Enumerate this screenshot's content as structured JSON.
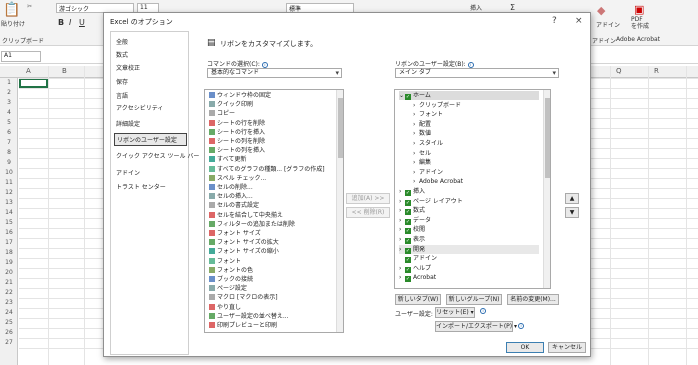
{
  "excel": {
    "font_name": "游ゴシック",
    "font_size": "11",
    "number_format": "標準",
    "clipboard_label": "クリップボード",
    "paste_label": "貼り付け",
    "insert_label": "挿入",
    "addin_label": "アドイン",
    "addin_group": "アドイン",
    "pdf_label": "PDF\nを作成",
    "acrobat_group": "Adobe Acrobat",
    "name_box": "A1",
    "columns": [
      "A",
      "B",
      "Q",
      "R"
    ],
    "rows": [
      "1",
      "2",
      "3",
      "4",
      "5",
      "6",
      "7",
      "8",
      "9",
      "10",
      "11",
      "12",
      "13",
      "14",
      "15",
      "16",
      "17",
      "18",
      "19",
      "20",
      "21",
      "22",
      "23",
      "24",
      "25",
      "26",
      "27"
    ]
  },
  "dialog": {
    "title": "Excel のオプション",
    "help": "?",
    "close": "×",
    "nav": [
      {
        "label": "全般"
      },
      {
        "label": "数式"
      },
      {
        "label": "文章校正"
      },
      {
        "label": "保存"
      },
      {
        "label": "言語"
      },
      {
        "label": "アクセシビリティ"
      },
      {
        "label": "詳細設定"
      },
      {
        "label": "リボンのユーザー設定"
      },
      {
        "label": "クイック アクセス ツール バー"
      },
      {
        "label": "アドイン"
      },
      {
        "label": "トラスト センター"
      }
    ],
    "header": "リボンをカスタマイズします。",
    "commands_label": "コマンドの選択(C):",
    "commands_value": "基本的なコマンド",
    "ribbon_label": "リボンのユーザー設定(B):",
    "ribbon_value": "メイン タブ",
    "commands": [
      "ウィンドウ枠の固定",
      "クイック印刷",
      "コピー",
      "シートの行を削除",
      "シートの行を挿入",
      "シートの列を削除",
      "シートの列を挿入",
      "すべて更新",
      "すべてのグラフの種類... [グラフの作成]",
      "スペル チェック...",
      "セルの削除...",
      "セルの挿入...",
      "セルの書式設定",
      "セルを結合して中央揃え",
      "フィルターの追加または削除",
      "フォント サイズ",
      "フォント サイズの拡大",
      "フォント サイズの縮小",
      "フォント",
      "フォントの色",
      "ブックの接続",
      "ページ設定",
      "マクロ [マクロの表示]",
      "やり直し",
      "ユーザー設定の並べ替え...",
      "印刷プレビューと印刷"
    ],
    "add_btn": "追加(A) >>",
    "remove_btn": "<< 削除(R)",
    "tabs": [
      {
        "label": "ホーム",
        "lvl": 0,
        "chk": true,
        "exp": "⌄"
      },
      {
        "label": "クリップボード",
        "lvl": 1,
        "chk": false,
        "exp": "›"
      },
      {
        "label": "フォント",
        "lvl": 1,
        "chk": false,
        "exp": "›"
      },
      {
        "label": "配置",
        "lvl": 1,
        "chk": false,
        "exp": "›"
      },
      {
        "label": "数値",
        "lvl": 1,
        "chk": false,
        "exp": "›"
      },
      {
        "label": "スタイル",
        "lvl": 1,
        "chk": false,
        "exp": "›"
      },
      {
        "label": "セル",
        "lvl": 1,
        "chk": false,
        "exp": "›"
      },
      {
        "label": "編集",
        "lvl": 1,
        "chk": false,
        "exp": "›"
      },
      {
        "label": "アドイン",
        "lvl": 1,
        "chk": false,
        "exp": "›"
      },
      {
        "label": "Adobe Acrobat",
        "lvl": 1,
        "chk": false,
        "exp": "›"
      },
      {
        "label": "挿入",
        "lvl": 0,
        "chk": true,
        "exp": "›"
      },
      {
        "label": "ページ レイアウト",
        "lvl": 0,
        "chk": true,
        "exp": "›"
      },
      {
        "label": "数式",
        "lvl": 0,
        "chk": true,
        "exp": "›"
      },
      {
        "label": "データ",
        "lvl": 0,
        "chk": true,
        "exp": "›"
      },
      {
        "label": "校閲",
        "lvl": 0,
        "chk": true,
        "exp": "›"
      },
      {
        "label": "表示",
        "lvl": 0,
        "chk": true,
        "exp": "›"
      },
      {
        "label": "開発",
        "lvl": 0,
        "chk": true,
        "exp": "›"
      },
      {
        "label": "アドイン",
        "lvl": 0,
        "chk": true,
        "exp": ""
      },
      {
        "label": "ヘルプ",
        "lvl": 0,
        "chk": true,
        "exp": "›"
      },
      {
        "label": "Acrobat",
        "lvl": 0,
        "chk": true,
        "exp": "›"
      }
    ],
    "new_tab_btn": "新しいタブ(W)",
    "new_group_btn": "新しいグループ(N)",
    "rename_btn": "名前の変更(M)...",
    "custom_label": "ユーザー設定:",
    "reset_btn": "リセット(E) ▾",
    "import_btn": "インポート/エクスポート(P) ▾",
    "ok_btn": "OK",
    "cancel_btn": "キャンセル",
    "up_arrow": "▲",
    "down_arrow": "▼"
  }
}
